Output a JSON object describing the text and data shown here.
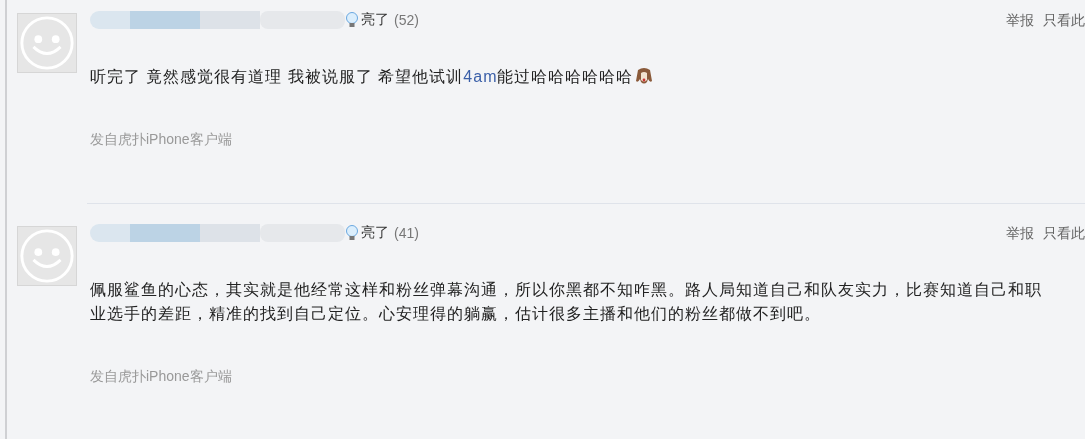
{
  "comments": [
    {
      "light_label": "亮了",
      "light_count": "(52)",
      "actions": [
        "举报",
        "只看此"
      ],
      "content": [
        {
          "text": "听完了 竟然感觉很有道理 我被说服了 希望他试训",
          "kind": "plain"
        },
        {
          "text": "4am",
          "kind": "link"
        },
        {
          "text": "能过哈哈哈哈哈哈",
          "kind": "plain"
        }
      ],
      "emoji": true,
      "source": "发自虎扑iPhone客户端"
    },
    {
      "light_label": "亮了",
      "light_count": "(41)",
      "actions": [
        "举报",
        "只看此"
      ],
      "content": [
        {
          "text": "佩服鲨鱼的心态，其实就是他经常这样和粉丝弹幕沟通，所以你黑都不知咋黑。路人局知道自己和队友实力，比赛知道自己和职业选手的差距，精准的找到自己定位。心安理得的躺赢，估计很多主播和他们的粉丝都做不到吧。",
          "kind": "plain"
        }
      ],
      "emoji": false,
      "source": "发自虎扑iPhone客户端"
    }
  ]
}
